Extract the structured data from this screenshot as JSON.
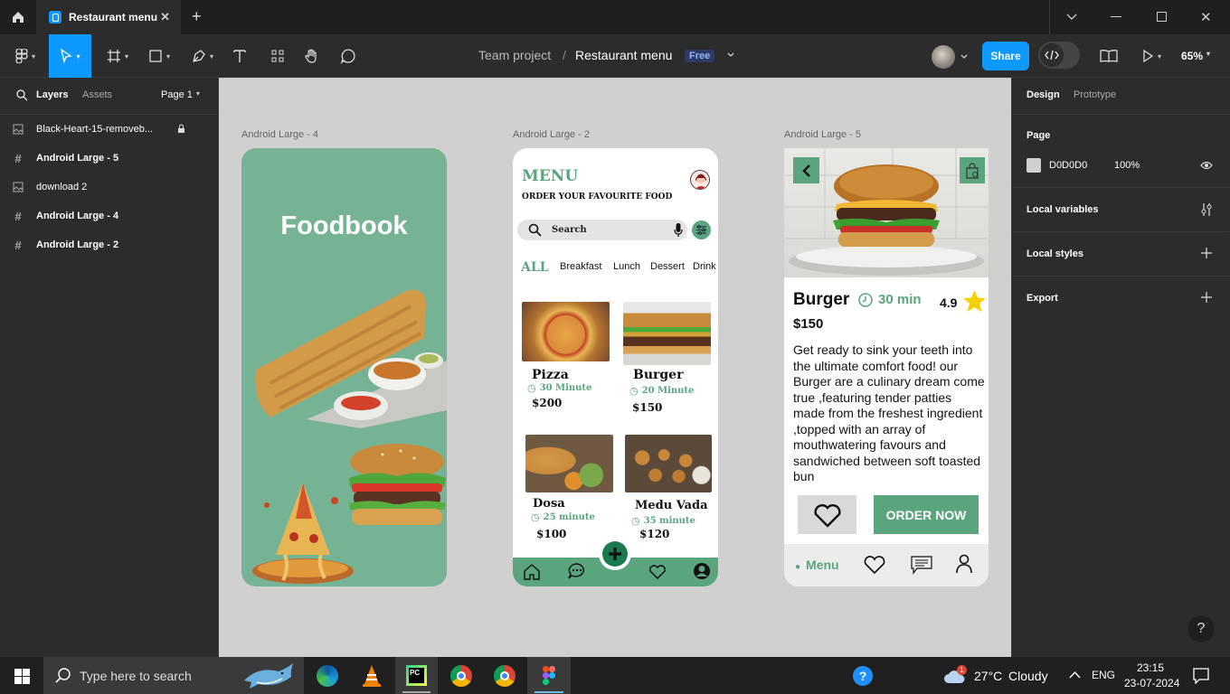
{
  "titlebar": {
    "tab_title": "Restaurant menu",
    "new_tab": "+"
  },
  "toolbar": {
    "breadcrumb_team": "Team project",
    "breadcrumb_sep": "/",
    "file_name": "Restaurant menu",
    "plan_badge": "Free",
    "share_label": "Share",
    "zoom": "65%"
  },
  "left_panel": {
    "tab_layers": "Layers",
    "tab_assets": "Assets",
    "page_selector": "Page 1",
    "layers": [
      {
        "name": "Black-Heart-15-removeb...",
        "icon": "image-icon",
        "locked": true
      },
      {
        "name": "Android Large - 5",
        "icon": "frame-icon"
      },
      {
        "name": "download 2",
        "icon": "image-icon"
      },
      {
        "name": "Android Large - 4",
        "icon": "frame-icon"
      },
      {
        "name": "Android Large - 2",
        "icon": "frame-icon"
      }
    ]
  },
  "right_panel": {
    "tab_design": "Design",
    "tab_prototype": "Prototype",
    "page_heading": "Page",
    "page_color": "D0D0D0",
    "page_opacity": "100%",
    "local_variables": "Local variables",
    "local_styles": "Local styles",
    "export": "Export"
  },
  "canvas": {
    "frames": {
      "frame4_label": "Android Large - 4",
      "frame2_label": "Android Large - 2",
      "frame5_label": "Android Large - 5"
    },
    "foodbook": {
      "title": "Foodbook"
    },
    "menu_screen": {
      "title": "MENU",
      "subtitle": "ORDER YOUR FAVOURITE FOOD",
      "search_placeholder": "Search",
      "categories": [
        "ALL",
        "Breakfast",
        "Lunch",
        "Dessert",
        "Drink"
      ],
      "items": [
        {
          "name": "Pizza",
          "time": "30 Minute",
          "price": "$200"
        },
        {
          "name": "Burger",
          "time": "20 Minute",
          "price": "$150"
        },
        {
          "name": "Dosa",
          "time": "25 minute",
          "price": "$100"
        },
        {
          "name": "Medu Vada",
          "time": "35 minute",
          "price": "$120"
        }
      ]
    },
    "detail_screen": {
      "name": "Burger",
      "time": "30 min",
      "rating": "4.9",
      "price": "$150",
      "description": "Get ready to sink your teeth into the ultimate comfort food! our Burger are a culinary dream come true ,featuring tender patties made from the freshest ingredient ,topped with an array of mouthwatering favours and sandwiched between soft toasted bun",
      "order_button": "ORDER NOW",
      "nav_menu": "Menu"
    },
    "help": "?"
  },
  "taskbar": {
    "search_placeholder": "Type here to search",
    "weather_temp": "27°C",
    "weather_desc": "Cloudy",
    "weather_badge": "1",
    "language": "ENG",
    "time": "23:15",
    "date": "23-07-2024"
  },
  "colors": {
    "accent": "#0d99ff",
    "brand_green": "#5aa47e",
    "foodbook_bg": "#76b394",
    "canvas_bg": "#d0d0d0"
  }
}
